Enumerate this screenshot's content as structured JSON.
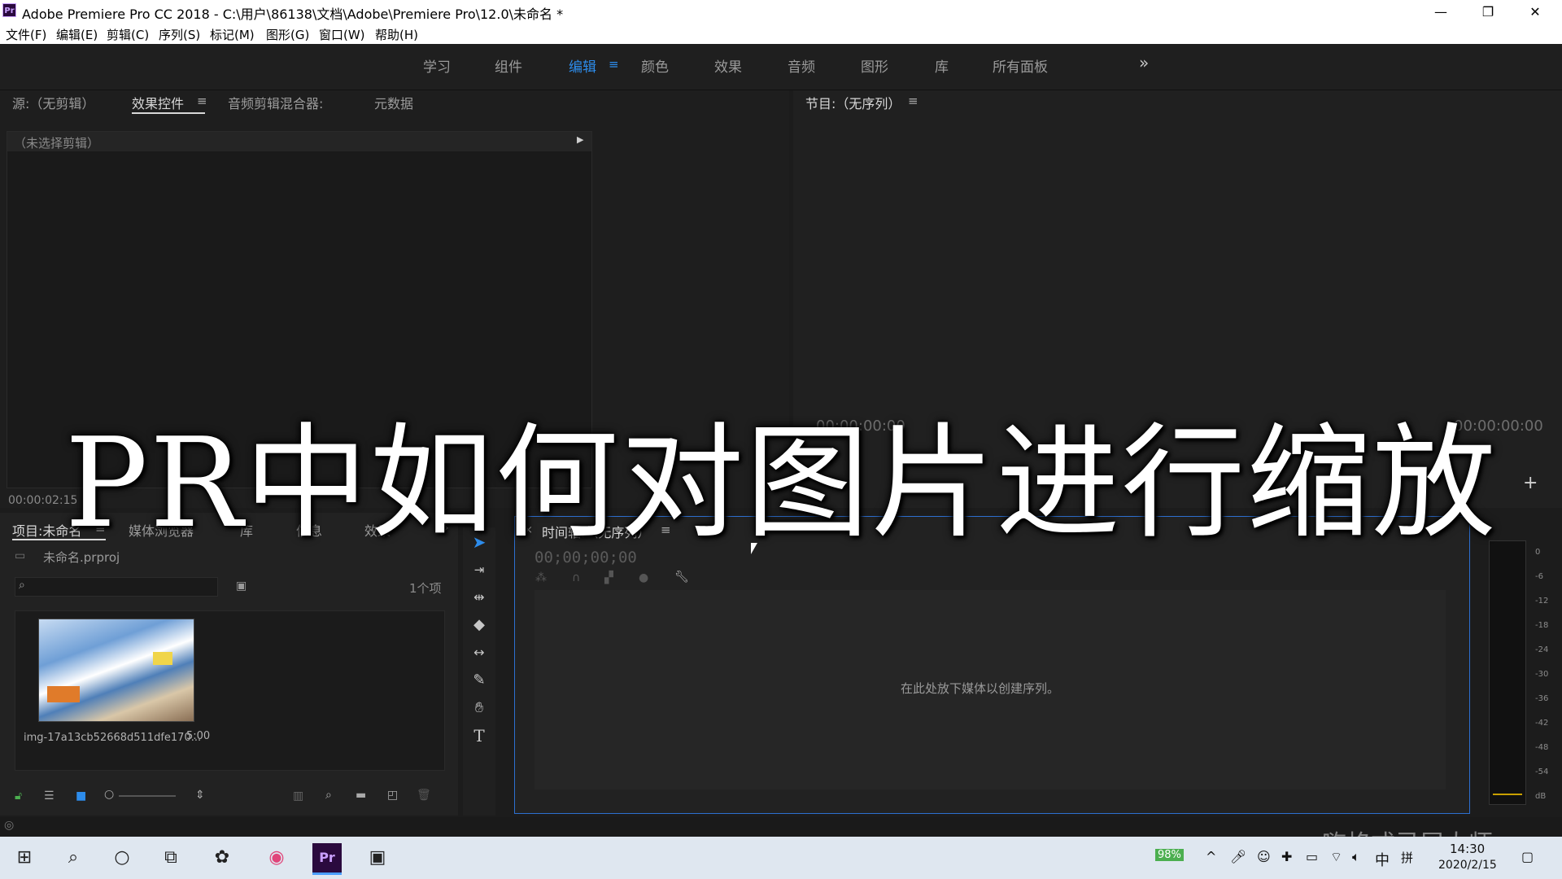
{
  "window": {
    "app_icon": "Pr",
    "title": "Adobe Premiere Pro CC 2018 - C:\\用户\\86138\\文档\\Adobe\\Premiere Pro\\12.0\\未命名 *",
    "minimize": "—",
    "restore": "❐",
    "close": "✕"
  },
  "menu": [
    "文件(F)",
    "编辑(E)",
    "剪辑(C)",
    "序列(S)",
    "标记(M)",
    "图形(G)",
    "窗口(W)",
    "帮助(H)"
  ],
  "workspaces": {
    "tabs": [
      "学习",
      "组件",
      "编辑",
      "颜色",
      "效果",
      "音频",
      "图形",
      "库",
      "所有面板"
    ],
    "active": "编辑",
    "overflow": "»",
    "accent": "#2d8ceb"
  },
  "source_panel": {
    "tabs": [
      "源:（无剪辑）",
      "效果控件",
      "音频剪辑混合器:",
      "元数据"
    ],
    "active_tab": "效果控件",
    "no_clip": "（未选择剪辑）",
    "timecode": "00:00:02:15"
  },
  "program_panel": {
    "title": "节目:（无序列）",
    "timecode_left": "00:00:00:00",
    "timecode_right": "00:00:00:00",
    "add_button": "+"
  },
  "project_panel": {
    "tabs": [
      "项目:未命名",
      "媒体浏览器",
      "库",
      "信息",
      "效果"
    ],
    "active_tab": "项目:未命名",
    "file": "未命名.prproj",
    "item_count": "1个项",
    "clip_name": "img-17a13cb52668d511dfe170...",
    "clip_duration": "5:00"
  },
  "timeline_panel": {
    "close": "×",
    "title": "时间轴:（无序列）",
    "timecode": "00;00;00;00",
    "drop_hint": "在此处放下媒体以创建序列。"
  },
  "audio_meter": {
    "labels": [
      "0",
      "-6",
      "-12",
      "-18",
      "-24",
      "-30",
      "-36",
      "-42",
      "-48",
      "-54",
      "dB"
    ]
  },
  "overlay_caption": "PR中如何对图片进行缩放",
  "watermark": "嗨格式录屏大师",
  "taskbar": {
    "battery": "98%",
    "ime": "中",
    "ime2": "拼",
    "time": "14:30",
    "date": "2020/2/15"
  }
}
